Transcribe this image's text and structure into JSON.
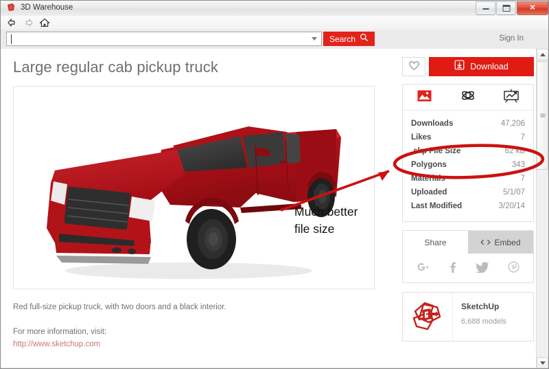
{
  "window": {
    "title": "3D Warehouse",
    "app_icon": "sketchup-icon",
    "controls": {
      "minimize": "minimize-button",
      "maximize": "maximize-button",
      "close": "close-button"
    }
  },
  "toolbar": {
    "back": "back-arrow-icon",
    "forward": "forward-arrow-icon",
    "home": "home-icon"
  },
  "search": {
    "value": "",
    "placeholder": "",
    "button_label": "Search",
    "dropdown": "chevron-down-icon",
    "sign_in": "Sign In"
  },
  "page": {
    "title": "Large regular cab pickup truck",
    "description_line1": "Red full-size pickup truck, with two doors and a black interior.",
    "description_line2": "For more information, visit:",
    "link": "http://www.sketchup.com"
  },
  "actions": {
    "favorite_icon": "heart-icon",
    "download_label": "Download",
    "download_icon": "download-icon"
  },
  "stats_tabs": [
    {
      "name": "photo-tab",
      "icon": "image-icon",
      "active": true
    },
    {
      "name": "model-tab",
      "icon": "orbit-3d-icon",
      "active": false
    },
    {
      "name": "stats-tab",
      "icon": "chart-presentation-icon",
      "active": false
    }
  ],
  "stats": [
    {
      "label": "Downloads",
      "value": "47,206"
    },
    {
      "label": "Likes",
      "value": "7"
    },
    {
      "label": ".skp File Size",
      "value": "62 kB",
      "highlighted": true
    },
    {
      "label": "Polygons",
      "value": "343"
    },
    {
      "label": "Materials",
      "value": "7"
    },
    {
      "label": "Uploaded",
      "value": "5/1/07"
    },
    {
      "label": "Last Modified",
      "value": "3/20/14"
    }
  ],
  "share": {
    "tab_share": "Share",
    "tab_embed": "Embed",
    "embed_icon": "code-brackets-icon",
    "socials": [
      {
        "name": "google-plus-icon",
        "glyph": "g+"
      },
      {
        "name": "facebook-icon",
        "glyph": "f"
      },
      {
        "name": "twitter-icon",
        "glyph": "t"
      },
      {
        "name": "pinterest-icon",
        "glyph": "p"
      }
    ]
  },
  "author": {
    "name": "SketchUp",
    "models": "6,688 models",
    "logo": "sketchup-logo-icon"
  },
  "annotation": {
    "line1": "Much better",
    "line2": "file size",
    "color": "#cc1111",
    "shape": "ellipse-and-arrow"
  },
  "colors": {
    "brand_red": "#e2231a",
    "download_red": "#e01b13",
    "annotation_red": "#cc1111",
    "title_gray": "#6f6f6f"
  },
  "model_preview": {
    "alt": "red pickup truck 3d model"
  }
}
